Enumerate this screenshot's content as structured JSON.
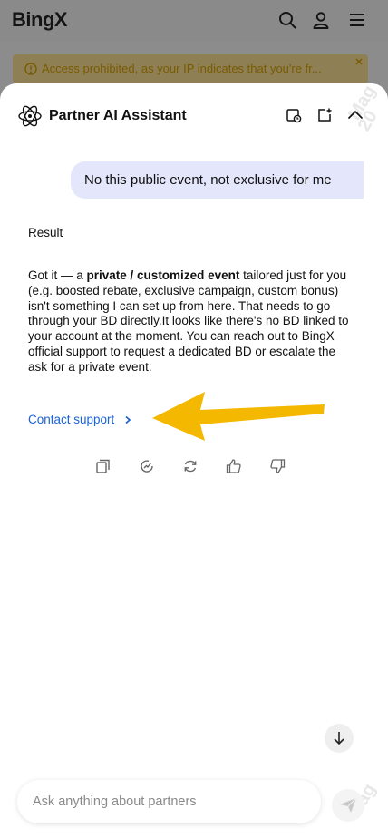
{
  "topbar": {
    "logo": "BingX",
    "icons": [
      "search-icon",
      "user-icon",
      "menu-icon"
    ]
  },
  "alert": {
    "text": "Access prohibited, as your IP indicates that you're fr...",
    "icon": "warning-icon",
    "close_icon": "close-icon"
  },
  "assistant": {
    "title": "Partner AI Assistant",
    "header_icons": [
      "history-icon",
      "new-chat-icon",
      "collapse-icon"
    ]
  },
  "conversation": {
    "user_message": "No this public event, not exclusive for me",
    "result_label": "Result",
    "reply": {
      "intro": "Got it — a ",
      "bold": "private / customized event",
      "body": " tailored just for you (e.g. boosted rebate, exclusive campaign, custom bonus) isn't something I can set up from here. That needs to go through your BD directly.It looks like there's no BD linked to your account at the moment. You can reach out to BingX official support to request a dedicated BD or escalate the ask for a private event:"
    },
    "contact_link": "Contact support",
    "action_icons": [
      "copy-icon",
      "regenerate-icon",
      "refresh-icon",
      "thumbs-up-icon",
      "thumbs-down-icon"
    ]
  },
  "composer": {
    "placeholder": "Ask anything about partners",
    "send_icon": "send-icon"
  },
  "colors": {
    "accent_link": "#1a63d6",
    "bubble": "#e4e7fb",
    "annotation_arrow": "#f5b800"
  }
}
